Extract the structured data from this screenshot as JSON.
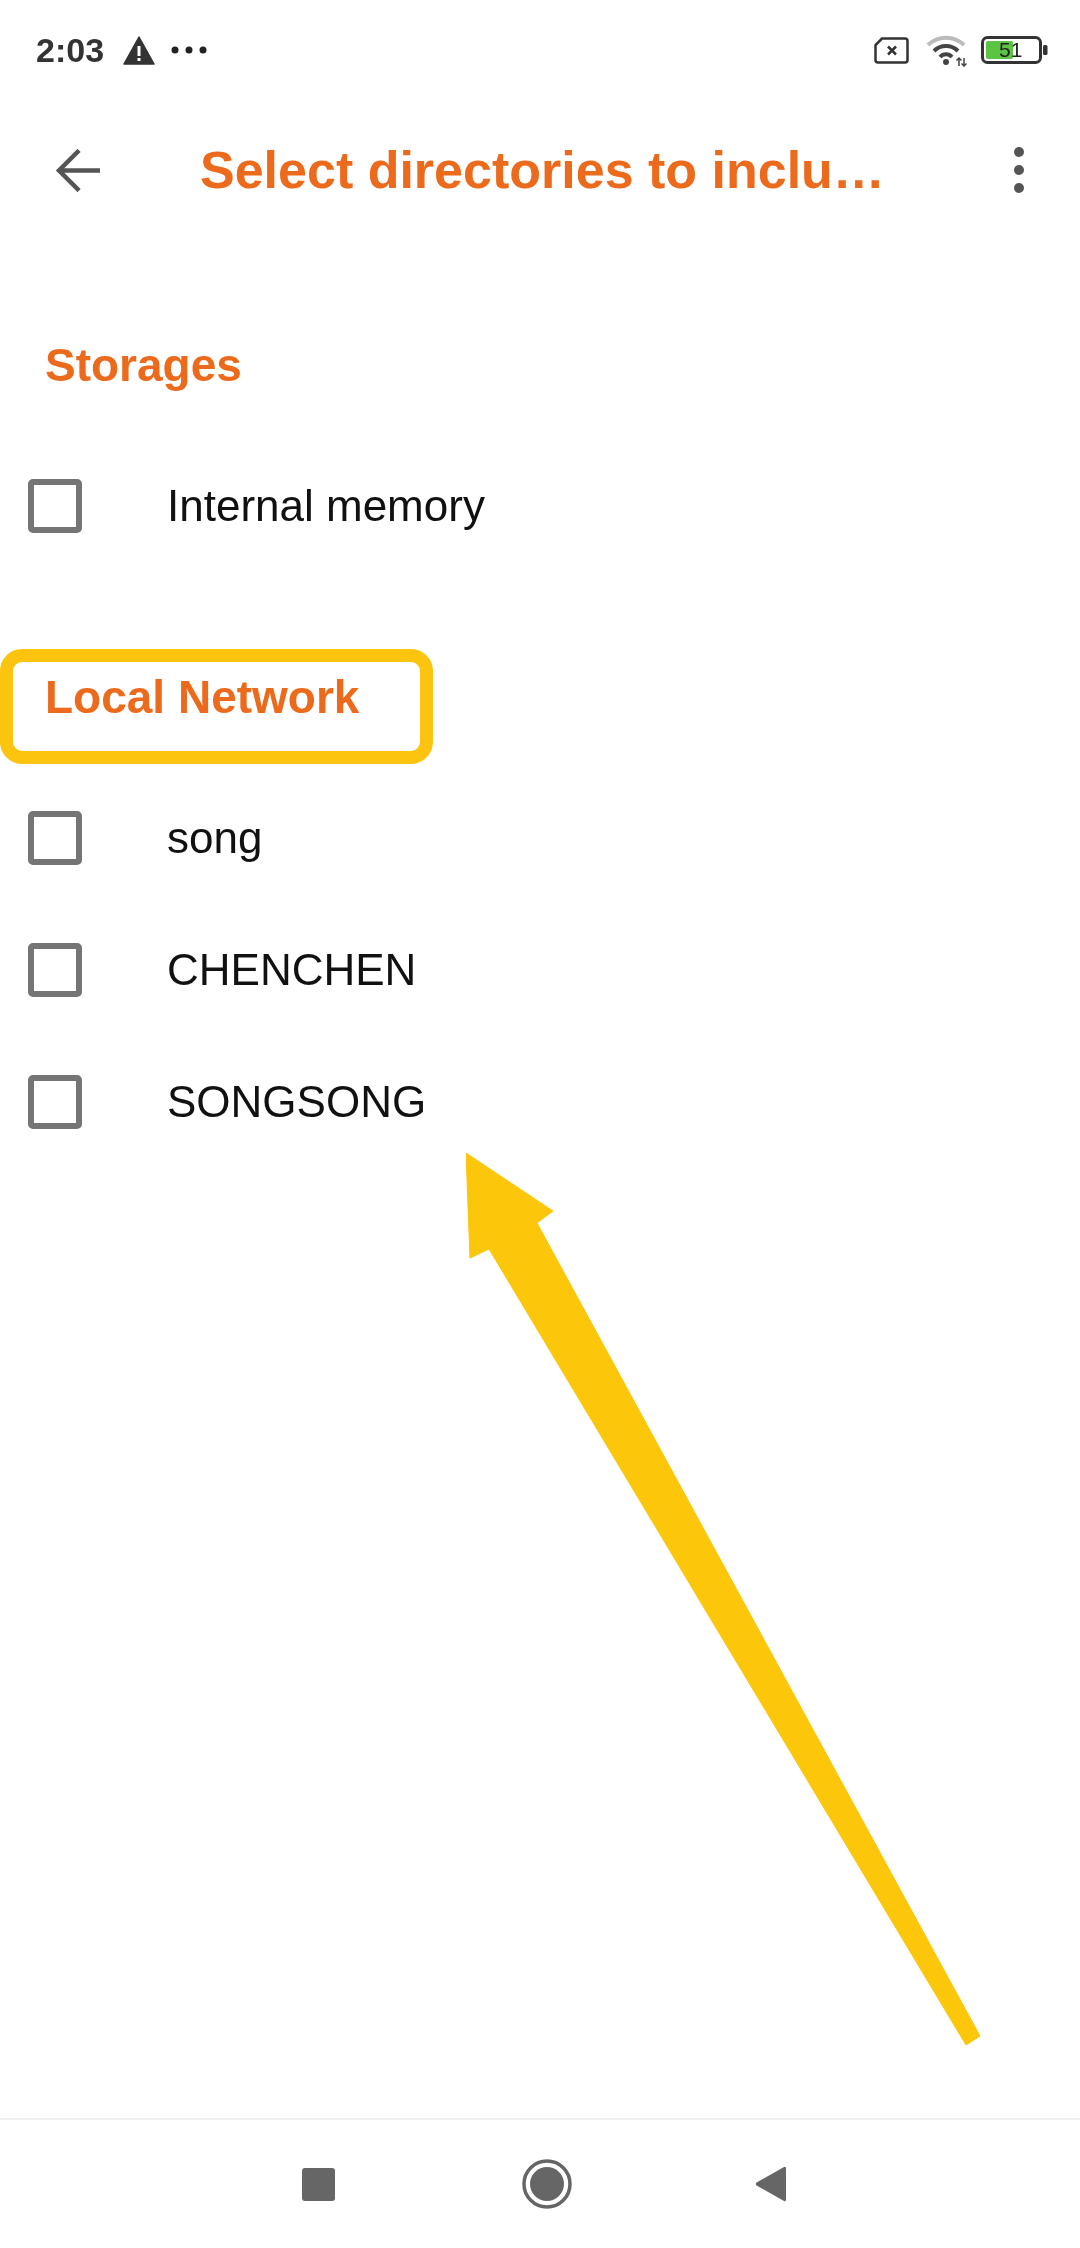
{
  "status_bar": {
    "time": "2:03",
    "battery": "51"
  },
  "toolbar": {
    "title": "Select directories to inclu…"
  },
  "sections": [
    {
      "title": "Storages",
      "highlighted": false,
      "items": [
        {
          "label": "Internal memory",
          "checked": false
        }
      ]
    },
    {
      "title": "Local Network",
      "highlighted": true,
      "items": [
        {
          "label": "song",
          "checked": false
        },
        {
          "label": "CHENCHEN",
          "checked": false
        },
        {
          "label": "SONGSONG",
          "checked": false
        }
      ]
    }
  ],
  "annotations": [
    {
      "kind": "arrow"
    }
  ]
}
